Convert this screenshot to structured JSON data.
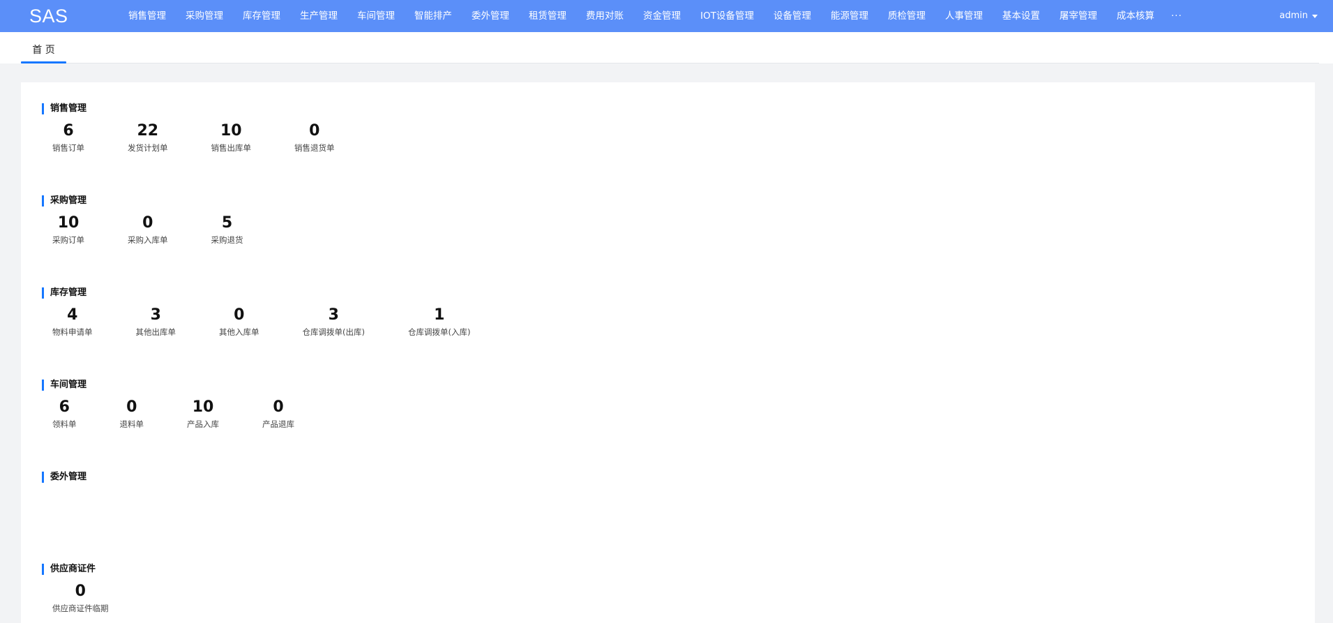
{
  "app": {
    "logo": "SAS"
  },
  "nav": {
    "items": [
      "销售管理",
      "采购管理",
      "库存管理",
      "生产管理",
      "车间管理",
      "智能排产",
      "委外管理",
      "租赁管理",
      "费用对账",
      "资金管理",
      "IOT设备管理",
      "设备管理",
      "能源管理",
      "质检管理",
      "人事管理",
      "基本设置",
      "屠宰管理",
      "成本核算"
    ],
    "more": "···",
    "user": "admin"
  },
  "tabs": [
    {
      "label": "首 页"
    }
  ],
  "colors": {
    "topbar": "#5b8ff9",
    "accent": "#1677ff",
    "page_bg": "#f2f3f5"
  },
  "sections": [
    {
      "title": "销售管理",
      "stats": [
        {
          "value": "6",
          "label": "销售订单"
        },
        {
          "value": "22",
          "label": "发货计划单"
        },
        {
          "value": "10",
          "label": "销售出库单"
        },
        {
          "value": "0",
          "label": "销售退货单"
        }
      ]
    },
    {
      "title": "采购管理",
      "stats": [
        {
          "value": "10",
          "label": "采购订单"
        },
        {
          "value": "0",
          "label": "采购入库单"
        },
        {
          "value": "5",
          "label": "采购退货"
        }
      ]
    },
    {
      "title": "库存管理",
      "stats": [
        {
          "value": "4",
          "label": "物料申请单"
        },
        {
          "value": "3",
          "label": "其他出库单"
        },
        {
          "value": "0",
          "label": "其他入库单"
        },
        {
          "value": "3",
          "label": "仓库调拨单(出库)"
        },
        {
          "value": "1",
          "label": "仓库调拨单(入库)"
        }
      ]
    },
    {
      "title": "车间管理",
      "stats": [
        {
          "value": "6",
          "label": "领料单"
        },
        {
          "value": "0",
          "label": "退料单"
        },
        {
          "value": "10",
          "label": "产品入库"
        },
        {
          "value": "0",
          "label": "产品退库"
        }
      ]
    },
    {
      "title": "委外管理",
      "stats": []
    },
    {
      "title": "供应商证件",
      "stats": [
        {
          "value": "0",
          "label": "供应商证件临期"
        }
      ]
    }
  ]
}
